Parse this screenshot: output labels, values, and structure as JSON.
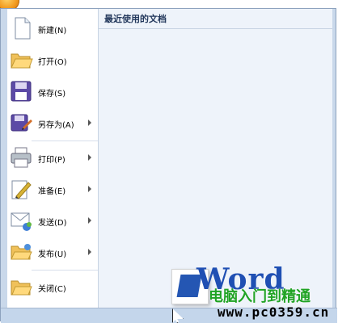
{
  "menu": {
    "items": [
      {
        "label": "新建(N)",
        "icon": "new-document-icon",
        "submenu": false
      },
      {
        "label": "打开(O)",
        "icon": "folder-open-icon",
        "submenu": false
      },
      {
        "label": "保存(S)",
        "icon": "save-icon",
        "submenu": false
      },
      {
        "label": "另存为(A)",
        "icon": "save-as-icon",
        "submenu": true
      },
      {
        "label": "打印(P)",
        "icon": "print-icon",
        "submenu": true
      },
      {
        "label": "准备(E)",
        "icon": "prepare-icon",
        "submenu": true
      },
      {
        "label": "发送(D)",
        "icon": "send-icon",
        "submenu": true
      },
      {
        "label": "发布(U)",
        "icon": "publish-icon",
        "submenu": true
      },
      {
        "label": "关闭(C)",
        "icon": "close-folder-icon",
        "submenu": false
      }
    ]
  },
  "recent": {
    "title": "最近使用的文档"
  },
  "watermark": {
    "logo_text": "Word",
    "brand": "电脑入门到精通",
    "url": "www.pc0359.cn"
  }
}
